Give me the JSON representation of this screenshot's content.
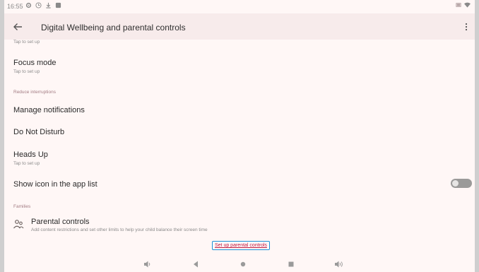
{
  "status_bar": {
    "time": "16:55",
    "icons": [
      "gear-icon",
      "clock-icon",
      "download-icon",
      "square-notification-icon"
    ],
    "right_icons": [
      "battery-icon",
      "wifi-icon"
    ]
  },
  "app_bar": {
    "title": "Digital Wellbeing and parental controls"
  },
  "items": {
    "partial_sub": "Tap to set up",
    "focus_title": "Focus mode",
    "focus_sub": "Tap to set up",
    "section_reduce": "Reduce interruptions",
    "manage_notifications": "Manage notifications",
    "do_not_disturb": "Do Not Disturb",
    "heads_up_title": "Heads Up",
    "heads_up_sub": "Tap to set up",
    "show_icon": "Show icon in the app list",
    "section_families": "Families",
    "parental_title": "Parental controls",
    "parental_sub": "Add content restrictions and set other limits to help your child balance their screen time",
    "setup_link": "Set up parental controls"
  },
  "toggle": {
    "on": false
  },
  "colors": {
    "background": "#fff7f6",
    "appbar": "#f7ebeb",
    "section_header": "#a27b82",
    "link": "#c0163c",
    "focus_outline": "#1a8fd6"
  },
  "nav_bar": {
    "icons": [
      "volume-down-icon",
      "back-icon",
      "home-icon",
      "recents-icon",
      "volume-up-icon"
    ]
  }
}
